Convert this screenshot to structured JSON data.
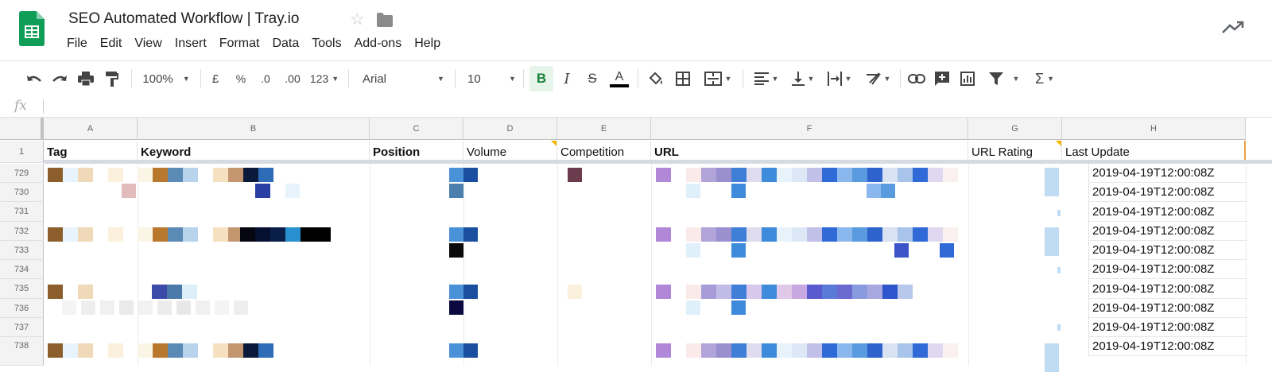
{
  "app": {
    "title": "SEO Automated Workflow | Tray.io"
  },
  "menu": [
    "File",
    "Edit",
    "View",
    "Insert",
    "Format",
    "Data",
    "Tools",
    "Add-ons",
    "Help"
  ],
  "toolbar": {
    "zoom": "100%",
    "currency": "£",
    "percent": "%",
    "dec_less": ".0",
    "dec_more": ".00",
    "num_format": "123",
    "font": "Arial",
    "font_size": "10",
    "bold": "B",
    "italic": "I",
    "strike": "S",
    "text_color": "A"
  },
  "formula_bar": {
    "fx": "fx",
    "value": ""
  },
  "columns": [
    "A",
    "B",
    "C",
    "D",
    "E",
    "F",
    "G",
    "H"
  ],
  "header_row": {
    "row_number": "1",
    "cells": [
      "Tag",
      "Keyword",
      "Position",
      "Volume",
      "Competition",
      "URL",
      "URL Rating",
      "Last Update"
    ]
  },
  "rows": [
    {
      "num": "729",
      "last_update": "2019-04-19T12:00:08Z"
    },
    {
      "num": "730",
      "last_update": "2019-04-19T12:00:08Z"
    },
    {
      "num": "731",
      "last_update": "2019-04-19T12:00:08Z"
    },
    {
      "num": "732",
      "last_update": "2019-04-19T12:00:08Z"
    },
    {
      "num": "733",
      "last_update": "2019-04-19T12:00:08Z"
    },
    {
      "num": "734",
      "last_update": "2019-04-19T12:00:08Z"
    },
    {
      "num": "735",
      "last_update": "2019-04-19T12:00:08Z"
    },
    {
      "num": "736",
      "last_update": "2019-04-19T12:00:08Z"
    },
    {
      "num": "737",
      "last_update": "2019-04-19T12:00:08Z"
    },
    {
      "num": "738",
      "last_update": "2019-04-19T12:00:08Z"
    }
  ],
  "colors": {
    "sheets_green": "#0f9d58",
    "bold_active": "#188038",
    "note_marker": "#f4b400"
  }
}
